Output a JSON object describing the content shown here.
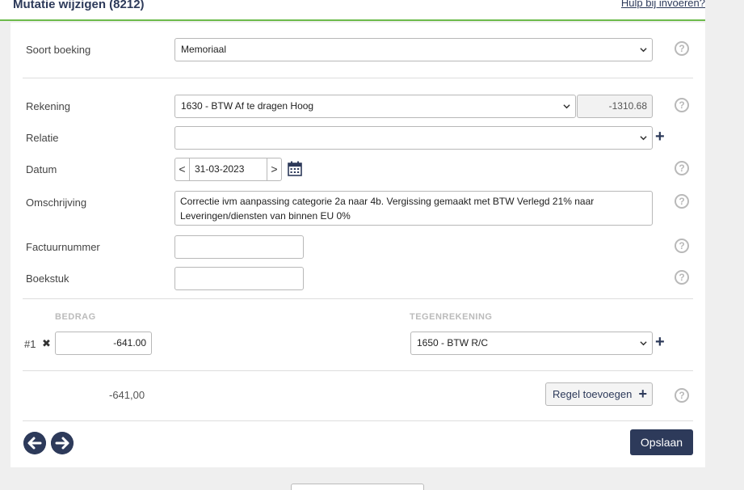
{
  "header": {
    "title": "Mutatie wijzigen (8212)",
    "help_link": "Hulp bij invoeren?"
  },
  "form": {
    "soort_boeking": {
      "label": "Soort boeking",
      "value": "Memoriaal"
    },
    "rekening": {
      "label": "Rekening",
      "value": "1630 - BTW Af te dragen Hoog",
      "saldo": "-1310.68"
    },
    "relatie": {
      "label": "Relatie",
      "value": ""
    },
    "datum": {
      "label": "Datum",
      "value": "31-03-2023",
      "prev": "<",
      "next": ">"
    },
    "omschrijving": {
      "label": "Omschrijving",
      "value": "Correctie ivm aanpassing categorie 2a naar 4b. Vergissing gemaakt met BTW Verlegd 21% naar Leveringen/diensten van binnen EU 0%"
    },
    "factuurnummer": {
      "label": "Factuurnummer",
      "value": ""
    },
    "boekstuk": {
      "label": "Boekstuk",
      "value": ""
    }
  },
  "lines": {
    "col_bedrag": "BEDRAG",
    "col_tegenrekening": "TEGENREKENING",
    "rows": [
      {
        "num": "#1",
        "remove": "✖",
        "bedrag": "-641.00",
        "tegenrekening": "1650 - BTW R/C"
      }
    ],
    "total": "-641,00",
    "add_line_label": "Regel toevoegen"
  },
  "footer": {
    "save_label": "Opslaan"
  },
  "icons": {
    "help": "?",
    "plus": "+"
  }
}
